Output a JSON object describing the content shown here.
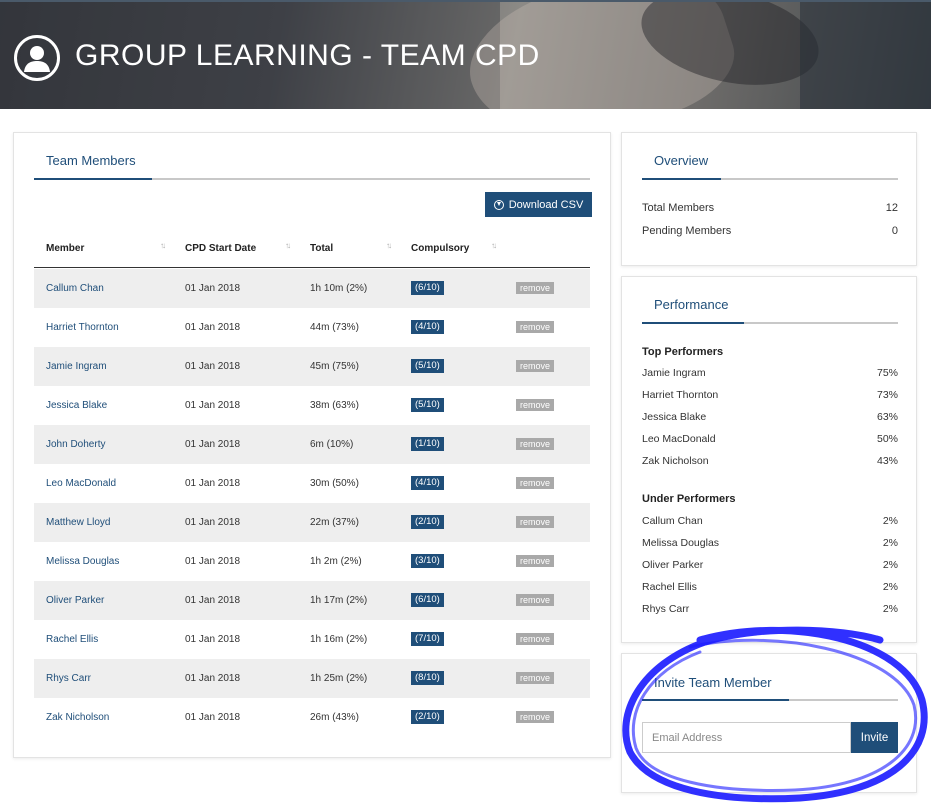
{
  "header": {
    "title": "GROUP LEARNING - TEAM CPD"
  },
  "team": {
    "tab_label": "Team Members",
    "download_label": "Download CSV",
    "columns": [
      "Member",
      "CPD Start Date",
      "Total",
      "Compulsory"
    ],
    "rows": [
      {
        "name": "Callum Chan",
        "date": "01 Jan 2018",
        "total": "1h 10m (2%)",
        "compulsory": "(6/10)",
        "action": "remove"
      },
      {
        "name": "Harriet Thornton",
        "date": "01 Jan 2018",
        "total": "44m (73%)",
        "compulsory": "(4/10)",
        "action": "remove"
      },
      {
        "name": "Jamie Ingram",
        "date": "01 Jan 2018",
        "total": "45m (75%)",
        "compulsory": "(5/10)",
        "action": "remove"
      },
      {
        "name": "Jessica Blake",
        "date": "01 Jan 2018",
        "total": "38m (63%)",
        "compulsory": "(5/10)",
        "action": "remove"
      },
      {
        "name": "John Doherty",
        "date": "01 Jan 2018",
        "total": "6m (10%)",
        "compulsory": "(1/10)",
        "action": "remove"
      },
      {
        "name": "Leo MacDonald",
        "date": "01 Jan 2018",
        "total": "30m (50%)",
        "compulsory": "(4/10)",
        "action": "remove"
      },
      {
        "name": "Matthew Lloyd",
        "date": "01 Jan 2018",
        "total": "22m (37%)",
        "compulsory": "(2/10)",
        "action": "remove"
      },
      {
        "name": "Melissa Douglas",
        "date": "01 Jan 2018",
        "total": "1h 2m (2%)",
        "compulsory": "(3/10)",
        "action": "remove"
      },
      {
        "name": "Oliver Parker",
        "date": "01 Jan 2018",
        "total": "1h 17m (2%)",
        "compulsory": "(6/10)",
        "action": "remove"
      },
      {
        "name": "Rachel Ellis",
        "date": "01 Jan 2018",
        "total": "1h 16m (2%)",
        "compulsory": "(7/10)",
        "action": "remove"
      },
      {
        "name": "Rhys Carr",
        "date": "01 Jan 2018",
        "total": "1h 25m (2%)",
        "compulsory": "(8/10)",
        "action": "remove"
      },
      {
        "name": "Zak Nicholson",
        "date": "01 Jan 2018",
        "total": "26m (43%)",
        "compulsory": "(2/10)",
        "action": "remove"
      }
    ]
  },
  "overview": {
    "tab_label": "Overview",
    "total_label": "Total Members",
    "total_value": "12",
    "pending_label": "Pending Members",
    "pending_value": "0"
  },
  "performance": {
    "tab_label": "Performance",
    "top_heading": "Top Performers",
    "top": [
      {
        "name": "Jamie Ingram",
        "value": "75%"
      },
      {
        "name": "Harriet Thornton",
        "value": "73%"
      },
      {
        "name": "Jessica Blake",
        "value": "63%"
      },
      {
        "name": "Leo MacDonald",
        "value": "50%"
      },
      {
        "name": "Zak Nicholson",
        "value": "43%"
      }
    ],
    "under_heading": "Under Performers",
    "under": [
      {
        "name": "Callum Chan",
        "value": "2%"
      },
      {
        "name": "Melissa Douglas",
        "value": "2%"
      },
      {
        "name": "Oliver Parker",
        "value": "2%"
      },
      {
        "name": "Rachel Ellis",
        "value": "2%"
      },
      {
        "name": "Rhys Carr",
        "value": "2%"
      }
    ]
  },
  "invite": {
    "tab_label": "Invite Team Member",
    "placeholder": "Email Address",
    "button_label": "Invite"
  },
  "colors": {
    "accent": "#1f4e79",
    "badge": "#1f4e79",
    "remove": "#a9a9a9",
    "annotation": "#1a1aff"
  },
  "icons": {
    "header": "user-circle-icon",
    "download": "download-circle-icon",
    "sort": "sort-arrows-icon"
  }
}
